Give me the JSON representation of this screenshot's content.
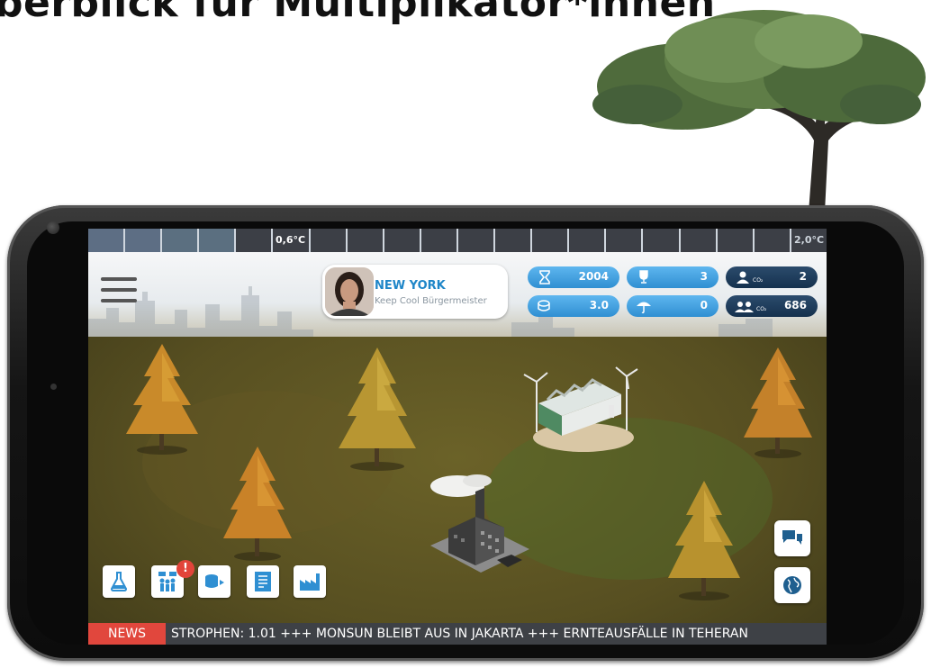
{
  "page_title": "berblick für Multiplikator*innen",
  "temperature": {
    "current": "0,6°C",
    "max": "2,0°C"
  },
  "profile": {
    "city": "NEW YORK",
    "role": "Keep Cool Bürgermeister"
  },
  "stats": {
    "year": "2004",
    "trophies": "3",
    "players": "2",
    "money": "3.0",
    "umbrella": "0",
    "co2": "686",
    "co2_sub": "CO₂"
  },
  "toolbar": {
    "research_icon": "flask-icon",
    "people_icon": "protest-icon",
    "people_alert": "!",
    "resources_icon": "coins-icon",
    "document_icon": "document-icon",
    "factory_icon": "factory-icon"
  },
  "side": {
    "chat_icon": "chat-icon",
    "globe_icon": "globe-icon"
  },
  "ticker": {
    "tag": "NEWS",
    "text": "STROPHEN: 1.01 +++ MONSUN BLEIBT AUS IN JAKARTA +++ ERNTEAUSFÄLLE IN TEHERAN"
  },
  "colors": {
    "accent_blue": "#2f8fd2",
    "dark_badge": "#15314e",
    "news_red": "#e1473d",
    "ground": "#5a5122"
  }
}
